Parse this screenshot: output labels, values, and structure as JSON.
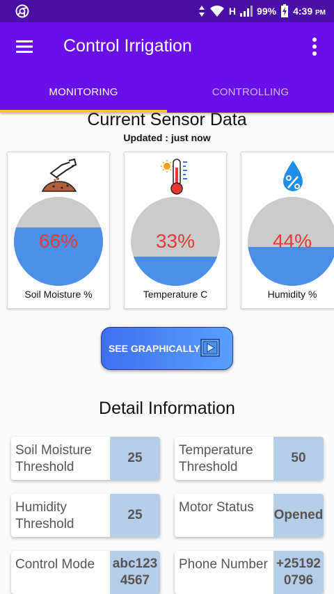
{
  "status_bar": {
    "battery": "99%",
    "time": "4:39",
    "ampm": "PM",
    "network": "H"
  },
  "app_bar": {
    "title": "Control Irrigation"
  },
  "tabs": [
    {
      "label": "MONITORING",
      "active": true
    },
    {
      "label": "CONTROLLING",
      "active": false
    }
  ],
  "sensor_section": {
    "title": "Current Sensor Data",
    "updated": "Updated : just now"
  },
  "sensors": [
    {
      "label": "Soil Moisture %",
      "value": "66%",
      "level": 66,
      "icon": "soil-hand-icon"
    },
    {
      "label": "Temperature C",
      "value": "33%",
      "level": 33,
      "icon": "thermometer-icon"
    },
    {
      "label": "Humidity %",
      "value": "44%",
      "level": 44,
      "icon": "humidity-drop-icon"
    }
  ],
  "graph_button": {
    "label": "SEE GRAPHICALLY",
    "icon": "play-icon"
  },
  "detail_section": {
    "title": "Detail Information"
  },
  "details": [
    {
      "label": "Soil Moisture Threshold",
      "value": "25"
    },
    {
      "label": "Temperature Threshold",
      "value": "50"
    },
    {
      "label": "Humidity Threshold",
      "value": "25"
    },
    {
      "label": "Motor Status",
      "value": "Opened"
    },
    {
      "label": "Control Mode",
      "value": "abc1234567"
    },
    {
      "label": "Phone Number",
      "value": "+251920796"
    }
  ],
  "colors": {
    "status_bar": "#4a0fa6",
    "app_bar": "#6b0fe8",
    "tab_indicator": "#f6c435",
    "gauge_fill": "#4c8fe8",
    "gauge_empty": "#cbcbcb",
    "gauge_text": "#e53935",
    "detail_value_bg": "#b5cde6"
  }
}
